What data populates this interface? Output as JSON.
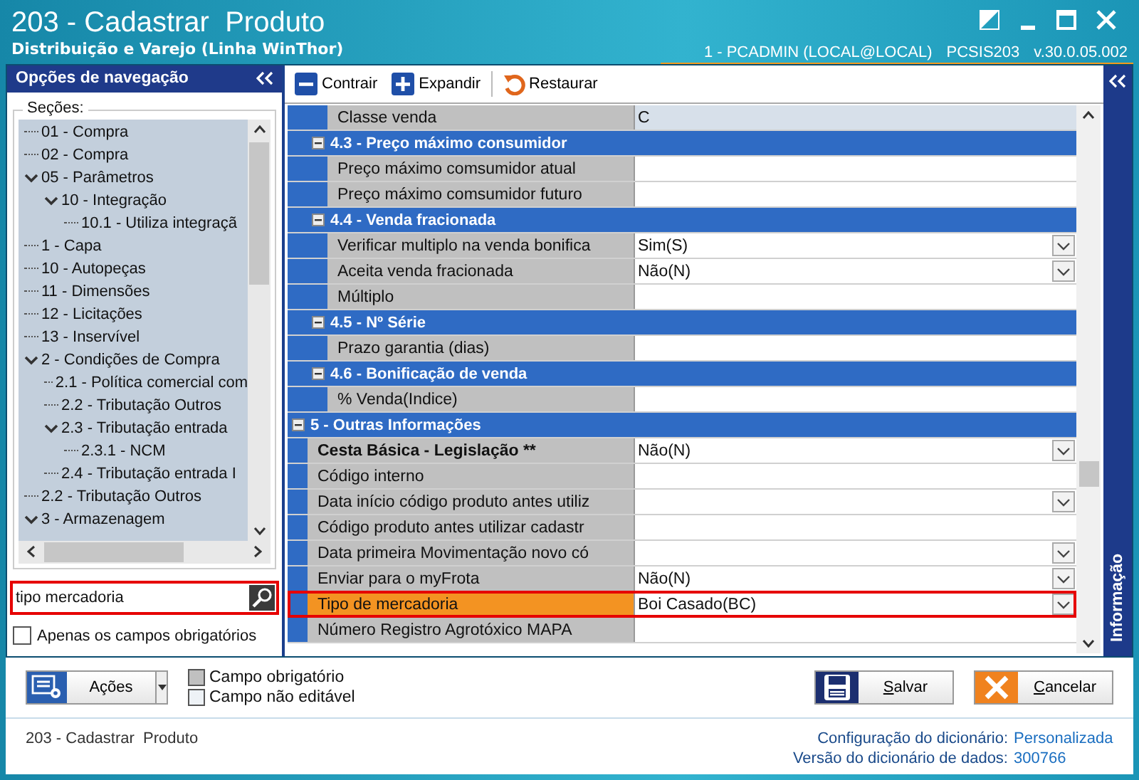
{
  "window": {
    "title": "203 - Cadastrar  Produto",
    "subtitle": "Distribuição e Varejo (Linha WinThor)",
    "session": [
      "1 - PCADMIN (LOCAL@LOCAL)",
      "PCSIS203",
      "v.30.0.05.002"
    ]
  },
  "navigation": {
    "title": "Opções de navegação",
    "sections_label": "Seções:",
    "tree": [
      {
        "label": "01 - Compra"
      },
      {
        "label": "02 - Compra"
      },
      {
        "label": "05 - Parâmetros",
        "expanded": true,
        "children": [
          {
            "label": "10 - Integração",
            "expanded": true,
            "children": [
              {
                "label": "10.1 - Utiliza integraçã"
              }
            ]
          }
        ]
      },
      {
        "label": "1 - Capa"
      },
      {
        "label": "10 - Autopeças"
      },
      {
        "label": "11 - Dimensões"
      },
      {
        "label": "12 - Licitações"
      },
      {
        "label": "13 - Inservível"
      },
      {
        "label": "2 - Condições de Compra",
        "expanded": true,
        "children": [
          {
            "label": "2.1 - Política comercial com"
          },
          {
            "label": "2.2 - Tributação Outros"
          },
          {
            "label": "2.3 - Tributação entrada",
            "expanded": true,
            "children": [
              {
                "label": "2.3.1 - NCM"
              }
            ]
          },
          {
            "label": "2.4 - Tributação entrada I"
          }
        ]
      },
      {
        "label": "2.2 - Tributação Outros"
      },
      {
        "label": "3 - Armazenagem",
        "expanded": true
      }
    ],
    "search": {
      "value": "tipo mercadoria",
      "highlighted": true
    },
    "required_only": {
      "label": "Apenas os campos obrigatórios",
      "checked": false
    }
  },
  "toolbar": [
    {
      "label": "Contrair",
      "kind": "collapse"
    },
    {
      "label": "Expandir",
      "kind": "expand"
    },
    {
      "label": "Restaurar",
      "kind": "restore"
    }
  ],
  "grid": [
    {
      "children": [
        {
          "children": [
            {
              "label": "Classe venda",
              "value": "C",
              "dropdown": false,
              "readonly": true,
              "required": false,
              "highlighted": false
            }
          ]
        },
        {
          "title": "4.3 - Preço máximo consumidor",
          "children": [
            {
              "label": "Preço máximo comsumidor atual",
              "dropdown": false,
              "readonly": false,
              "required": false,
              "highlighted": false
            },
            {
              "label": "Preço máximo comsumidor futuro",
              "dropdown": false,
              "readonly": false,
              "required": false,
              "highlighted": false
            }
          ]
        },
        {
          "title": "4.4 - Venda fracionada",
          "children": [
            {
              "label": "Verificar multiplo na venda bonifica",
              "value": "Sim(S)",
              "dropdown": true,
              "readonly": false,
              "required": false,
              "highlighted": false
            },
            {
              "label": "Aceita venda fracionada",
              "value": "Não(N)",
              "dropdown": true,
              "readonly": false,
              "required": false,
              "highlighted": false
            },
            {
              "label": "Múltiplo",
              "dropdown": false,
              "readonly": false,
              "required": false,
              "highlighted": false
            }
          ]
        },
        {
          "title": "4.5 - Nº Série",
          "children": [
            {
              "label": "Prazo garantia (dias)",
              "dropdown": false,
              "readonly": false,
              "required": false,
              "highlighted": false
            }
          ]
        },
        {
          "title": "4.6 - Bonificação de venda",
          "children": [
            {
              "label": "% Venda(Indice)",
              "dropdown": false,
              "readonly": false,
              "required": false,
              "highlighted": false
            }
          ]
        }
      ]
    },
    {
      "title": "5 - Outras Informações",
      "children": [
        {
          "label": "Cesta Básica - Legislação **",
          "value": "Não(N)",
          "dropdown": true,
          "readonly": false,
          "required": true,
          "highlighted": false
        },
        {
          "label": "Código interno",
          "dropdown": false,
          "readonly": false,
          "required": false,
          "highlighted": false
        },
        {
          "label": "Data início código produto antes utiliz",
          "dropdown": true,
          "readonly": false,
          "required": false,
          "highlighted": false
        },
        {
          "label": "Código produto antes utilizar cadastr",
          "dropdown": false,
          "readonly": false,
          "required": false,
          "highlighted": false
        },
        {
          "label": "Data primeira Movimentação novo có",
          "dropdown": true,
          "readonly": false,
          "required": false,
          "highlighted": false
        },
        {
          "label": "Enviar para o myFrota",
          "value": "Não(N)",
          "dropdown": true,
          "readonly": false,
          "required": false,
          "highlighted": false
        },
        {
          "label": "Tipo de mercadoria",
          "value": "Boi Casado(BC)",
          "dropdown": true,
          "readonly": false,
          "required": false,
          "highlighted": true
        },
        {
          "label": "Número Registro Agrotóxico MAPA",
          "dropdown": false,
          "readonly": false,
          "required": false,
          "highlighted": false
        }
      ]
    }
  ],
  "side_tab": "Informação",
  "actions": {
    "label": "Ações"
  },
  "legend": [
    {
      "label": "Campo obrigatório",
      "color": "#c0c0c0"
    },
    {
      "label": "Campo não editável",
      "color": "#eef2f6"
    }
  ],
  "buttons": [
    {
      "label": "Salvar",
      "kind": "save"
    },
    {
      "label": "Cancelar",
      "kind": "cancel"
    }
  ],
  "footer": {
    "screen": "203 - Cadastrar  Produto",
    "info": [
      {
        "label": "Configuração do dicionário:",
        "value": "Personalizada"
      },
      {
        "label": "Versão do dicionário de dados:",
        "value": "300766"
      }
    ]
  }
}
